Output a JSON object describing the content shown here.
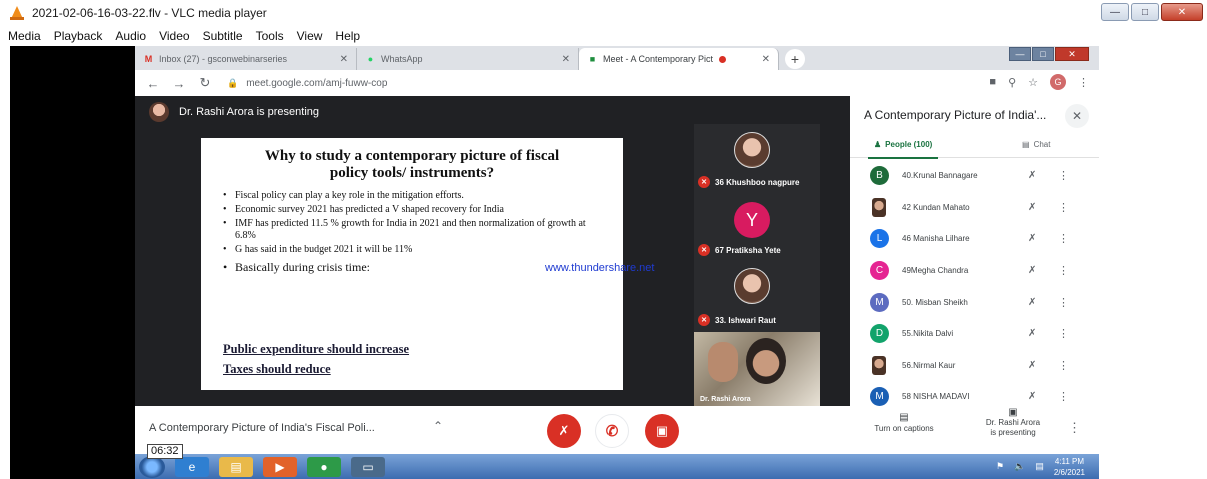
{
  "vlc": {
    "title": "2021-02-06-16-03-22.flv - VLC media player",
    "menu": [
      "Media",
      "Playback",
      "Audio",
      "Video",
      "Subtitle",
      "Tools",
      "View",
      "Help"
    ]
  },
  "browser": {
    "tabs": [
      {
        "label": "Inbox (27) - gsconwebinarseries",
        "icon": "gmail-icon"
      },
      {
        "label": "WhatsApp",
        "icon": "whatsapp-icon"
      },
      {
        "label": "Meet - A Contemporary Pict",
        "icon": "meet-icon"
      }
    ],
    "url": "meet.google.com/amj-fuww-cop",
    "profile_initial": "G"
  },
  "meet": {
    "presenting_text": "Dr. Rashi Arora is presenting",
    "slide": {
      "title_line1": "Why to study a contemporary picture of fiscal",
      "title_line2": "policy tools/ instruments?",
      "bullets": [
        "Fiscal policy can play a key role in the mitigation efforts.",
        "Economic survey 2021 has predicted a V shaped recovery for India",
        "IMF has predicted 11.5 % growth for India in 2021 and then normalization of growth at 6.8%",
        "G has said in the budget 2021 it will be 11%",
        "Basically during crisis time:"
      ],
      "underline1": "Public expenditure should increase",
      "underline2": "Taxes should reduce"
    },
    "watermark": "www.thundershare.net",
    "tiles": [
      {
        "name": "36 Khushboo nagpure"
      },
      {
        "name": "67 Pratiksha Yete",
        "letter": "Y"
      },
      {
        "name": "33. Ishwari Raut"
      }
    ],
    "self_name": "Dr. Rashi Arora",
    "panel": {
      "title": "A Contemporary Picture of India'...",
      "people_tab": "People (100)",
      "chat_tab": "Chat",
      "people": [
        {
          "initial": "B",
          "name": "40.Krunal Bannagare",
          "color": "#1e6b3a"
        },
        {
          "initial": "",
          "name": "42 Kundan Mahato",
          "color": "#555555"
        },
        {
          "initial": "L",
          "name": "46 Manisha Lilhare",
          "color": "#1a73e8"
        },
        {
          "initial": "C",
          "name": "49Megha Chandra",
          "color": "#e52592"
        },
        {
          "initial": "M",
          "name": "50. Misban Sheikh",
          "color": "#5c6bc0"
        },
        {
          "initial": "D",
          "name": "55.Nikita Dalvi",
          "color": "#12a36b"
        },
        {
          "initial": "",
          "name": "56.Nirmal Kaur",
          "color": "#555555"
        },
        {
          "initial": "M",
          "name": "58 NISHA MADAVI",
          "color": "#1a5fb4"
        }
      ]
    },
    "meeting_name": "A Contemporary Picture of India's Fiscal Poli...",
    "captions_label": "Turn on captions",
    "presenting_label_line1": "Dr. Rashi Arora",
    "presenting_label_line2": "is presenting"
  },
  "timestamp": "06:32",
  "taskbar": {
    "time": "4:11 PM",
    "date": "2/6/2021"
  }
}
